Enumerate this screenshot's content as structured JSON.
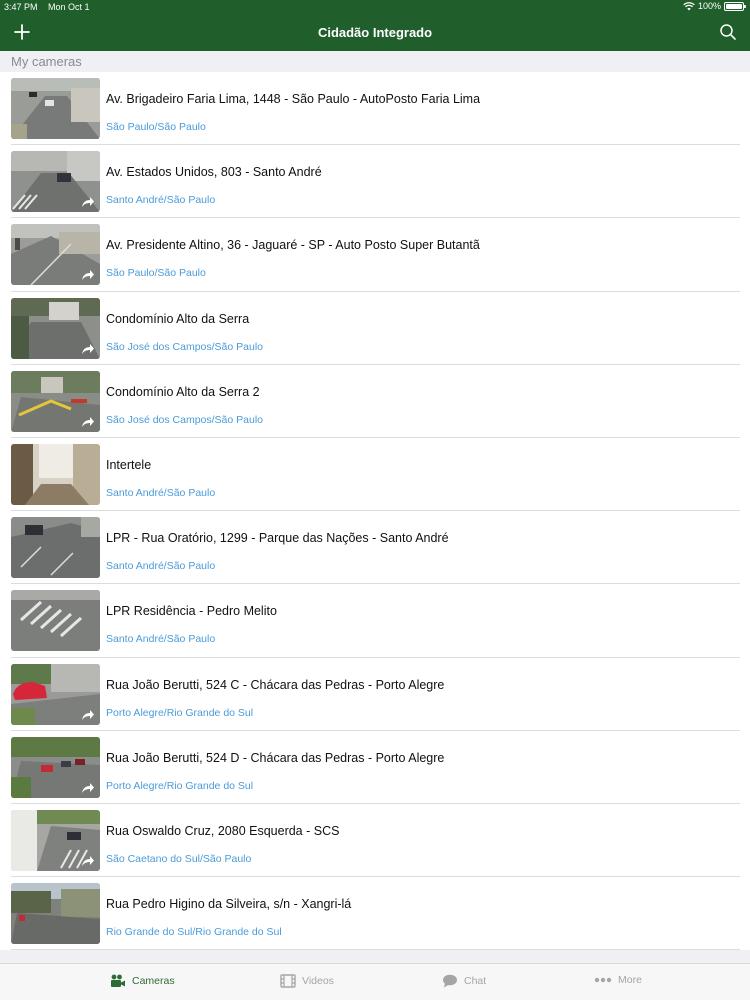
{
  "status": {
    "time": "3:47 PM",
    "date": "Mon Oct 1",
    "battery": "100%"
  },
  "nav": {
    "title": "Cidadão Integrado"
  },
  "section": {
    "header": "My cameras"
  },
  "cameras": [
    {
      "name": "Av. Brigadeiro Faria Lima, 1448 - São Paulo - AutoPosto Faria Lima",
      "location": "São Paulo/São Paulo",
      "shared": false
    },
    {
      "name": "Av. Estados Unidos, 803 - Santo André",
      "location": "Santo André/São Paulo",
      "shared": true
    },
    {
      "name": "Av. Presidente Altino, 36 - Jaguaré - SP - Auto Posto Super Butantã",
      "location": "São Paulo/São Paulo",
      "shared": true
    },
    {
      "name": "Condomínio Alto da Serra",
      "location": "São José dos Campos/São Paulo",
      "shared": true
    },
    {
      "name": "Condomínio Alto da Serra 2",
      "location": "São José dos Campos/São Paulo",
      "shared": true
    },
    {
      "name": "Intertele",
      "location": "Santo André/São Paulo",
      "shared": false
    },
    {
      "name": "LPR - Rua Oratório, 1299 - Parque das Nações - Santo André",
      "location": "Santo André/São Paulo",
      "shared": false
    },
    {
      "name": "LPR Residência - Pedro Melito",
      "location": "Santo André/São Paulo",
      "shared": false
    },
    {
      "name": "Rua João Berutti, 524 C - Chácara das Pedras - Porto Alegre",
      "location": "Porto Alegre/Rio Grande do Sul",
      "shared": true
    },
    {
      "name": "Rua João Berutti, 524 D - Chácara das Pedras - Porto Alegre",
      "location": "Porto Alegre/Rio Grande do Sul",
      "shared": true
    },
    {
      "name": "Rua Oswaldo Cruz, 2080 Esquerda - SCS",
      "location": "São Caetano do Sul/São Paulo",
      "shared": true
    },
    {
      "name": "Rua Pedro Higino da Silveira, s/n - Xangri-lá",
      "location": "Rio Grande do Sul/Rio Grande do Sul",
      "shared": false
    }
  ],
  "tabs": [
    {
      "label": "Cameras",
      "icon": "camera-icon",
      "active": true
    },
    {
      "label": "Videos",
      "icon": "film-icon",
      "active": false
    },
    {
      "label": "Chat",
      "icon": "chat-bubble-icon",
      "active": false
    },
    {
      "label": "More",
      "icon": "more-dots-icon",
      "active": false
    }
  ],
  "colors": {
    "brand": "#205f2b",
    "link": "#4a9bd9",
    "active_tab": "#2e6b35"
  }
}
